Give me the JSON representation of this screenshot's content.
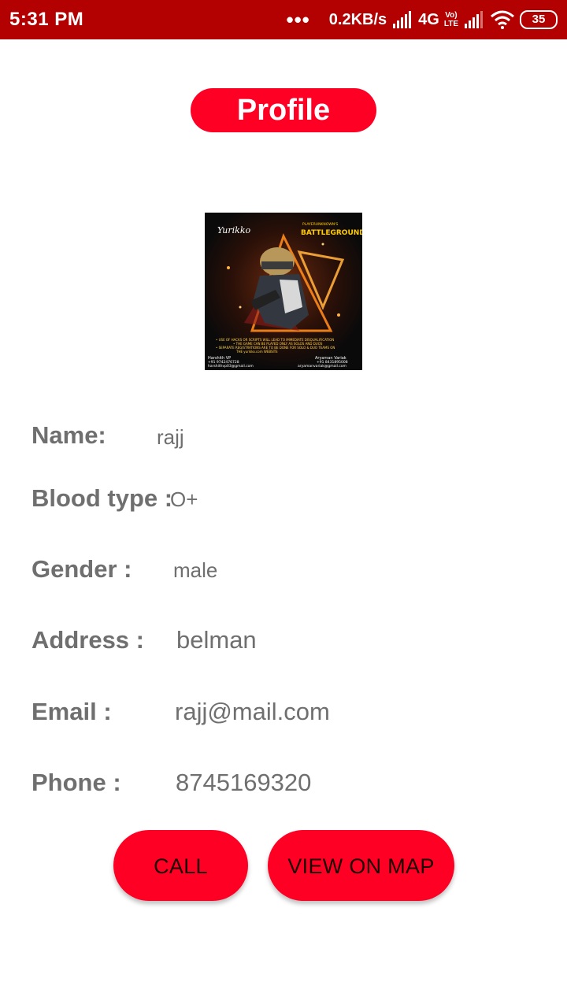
{
  "status_bar": {
    "time": "5:31 PM",
    "dots": "•••",
    "net_speed": "0.2KB/s",
    "net_type": "4G",
    "volte_top": "Vo)",
    "volte_bottom": "LTE",
    "battery": "35",
    "icons": [
      "signal-icon",
      "wifi-icon",
      "battery-icon"
    ]
  },
  "header": {
    "title": "Profile"
  },
  "profile": {
    "name_label": "Name:",
    "name": "rajj",
    "blood_label": "Blood type :",
    "blood": "O+",
    "gender_label": "Gender :",
    "gender": "male",
    "address_label": "Address :",
    "address": "belman",
    "email_label": "Email :",
    "email": "rajj@mail.com",
    "phone_label": "Phone :",
    "phone": "8745169320"
  },
  "image_text": {
    "logo": "Yurikko",
    "brand_top": "PLAYERUNKNOWN'S",
    "brand": "BATTLEGROUNDS",
    "rules": [
      "• USE OF HACKS OR SCRIPTS WILL LEAD TO IMMEDIATE DISQUALIFICATION",
      "• THE GAME CAN BE PLAYED ONLY AS SOLOS AND DUOS",
      "• SEPARATE REGISTRATIONS ARE TO BE DONE FOR SOLO & DUO TEAMS ON",
      "THE yurikko.com WEBSITE"
    ],
    "contact_left": [
      "Harshith VP",
      "+91 9742476728",
      "harshithvp03@gmail.com"
    ],
    "contact_right": [
      "Aryaman Variak",
      "+91 8431895008",
      "aryamanvariak@gmail.com"
    ]
  },
  "buttons": {
    "call": "CALL",
    "map": "VIEW ON MAP"
  },
  "colors": {
    "status_bar": "#b30000",
    "accent": "#ff0025",
    "text": "#6f6f6f"
  }
}
